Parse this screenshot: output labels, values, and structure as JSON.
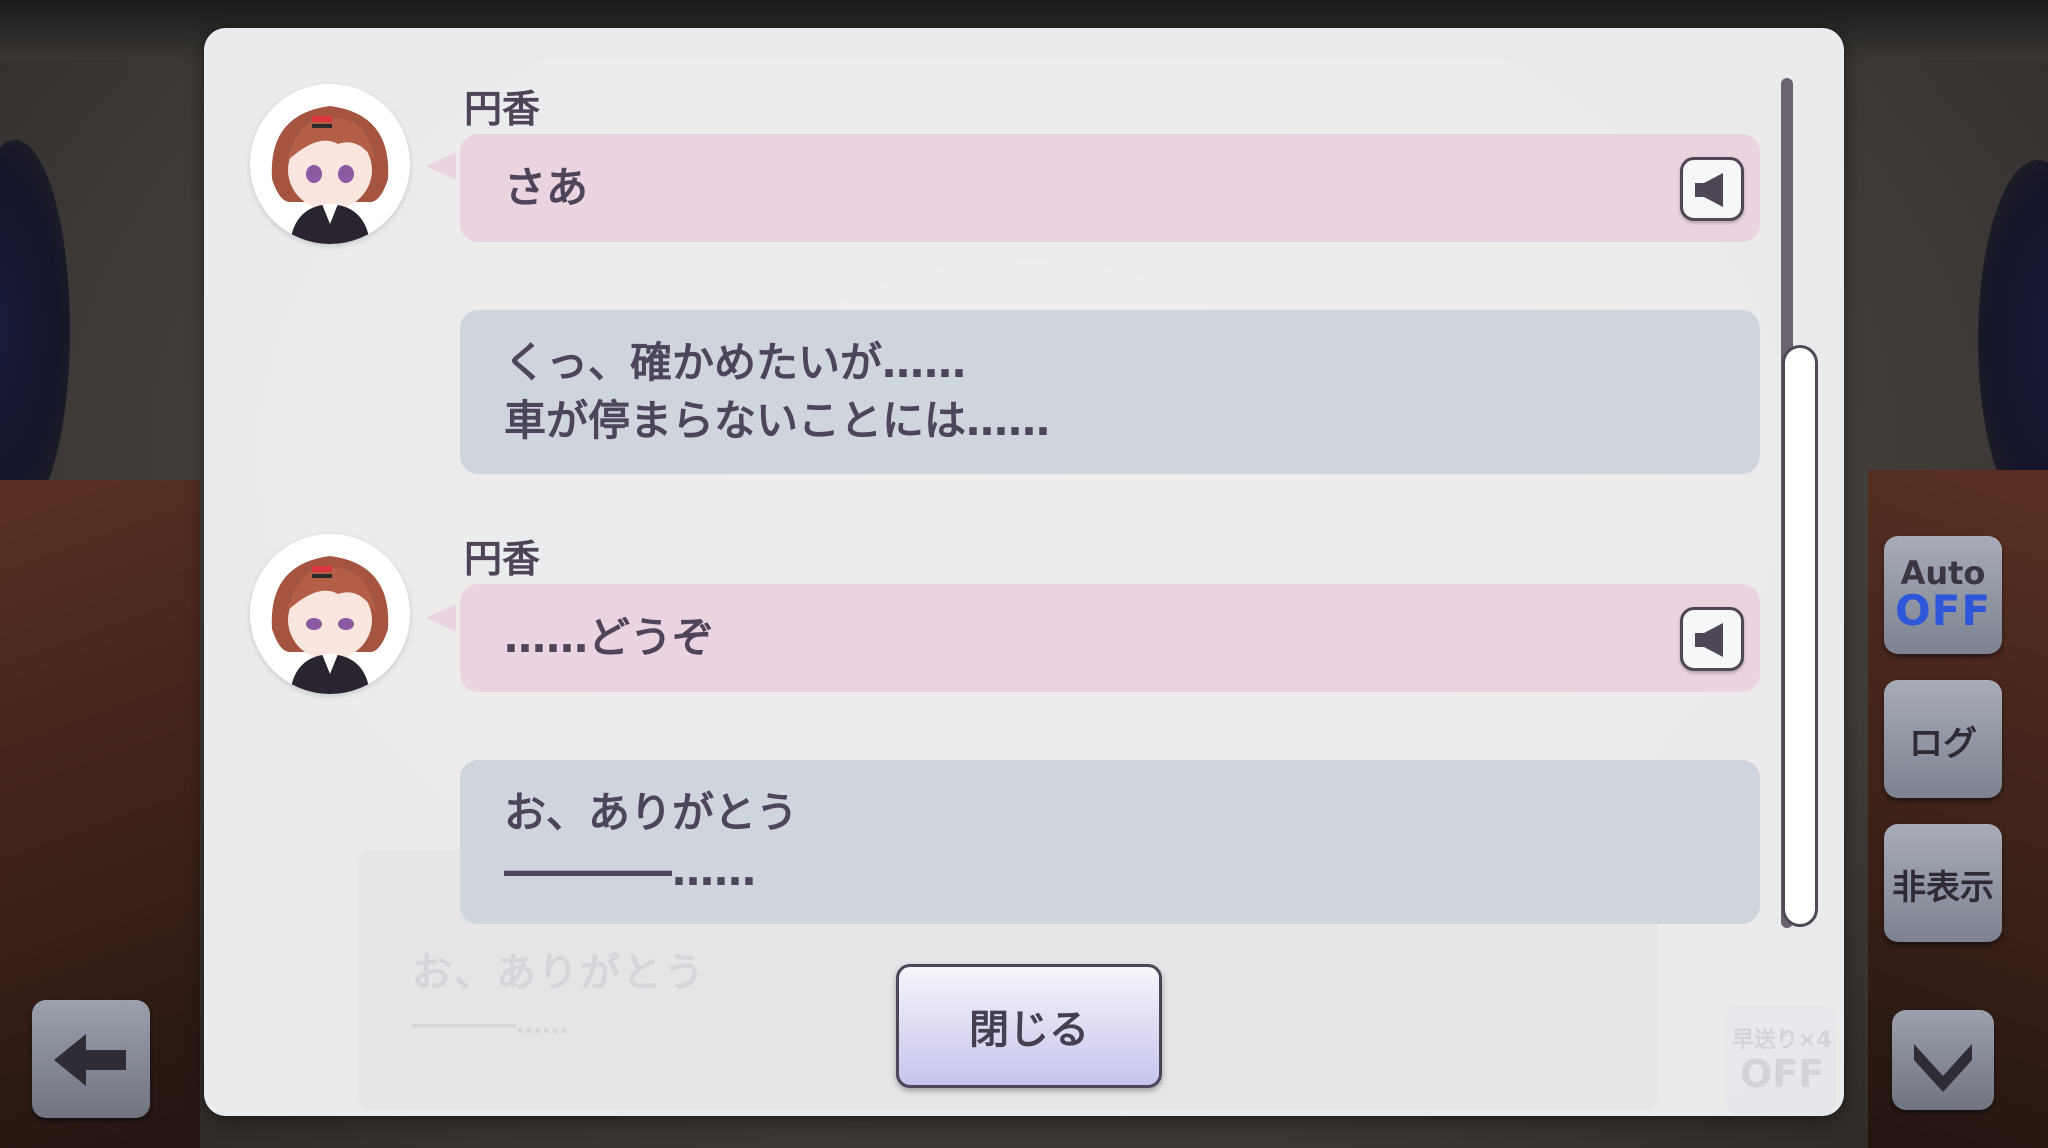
{
  "log": {
    "entries": [
      {
        "speaker": "円香",
        "lines": [
          "さあ"
        ],
        "type": "character",
        "has_voice": true
      },
      {
        "speaker": "",
        "lines": [
          "くっ、確かめたいが……",
          "車が停まらないことには……"
        ],
        "type": "player",
        "has_voice": false
      },
      {
        "speaker": "円香",
        "lines": [
          "……どうぞ"
        ],
        "type": "character",
        "has_voice": true
      },
      {
        "speaker": "",
        "lines": [
          "お、ありがとう",
          "――――……"
        ],
        "type": "player",
        "has_voice": false
      }
    ],
    "close_label": "閉じる"
  },
  "side_controls": {
    "auto_label": "Auto",
    "auto_state": "OFF",
    "log_label": "ログ",
    "hide_label": "非表示"
  },
  "background_window": {
    "text": "お、ありがとう",
    "subtext": "――――……",
    "fast_forward_label": "早送り×4",
    "fast_forward_state": "OFF"
  },
  "colors": {
    "character_bubble": "#ecd3e0",
    "player_bubble": "#cfd5dd",
    "auto_off": "#2d56d8",
    "text": "#4d4559"
  },
  "icons": [
    "speaker-icon",
    "back-arrow-icon",
    "chevron-down-icon"
  ]
}
